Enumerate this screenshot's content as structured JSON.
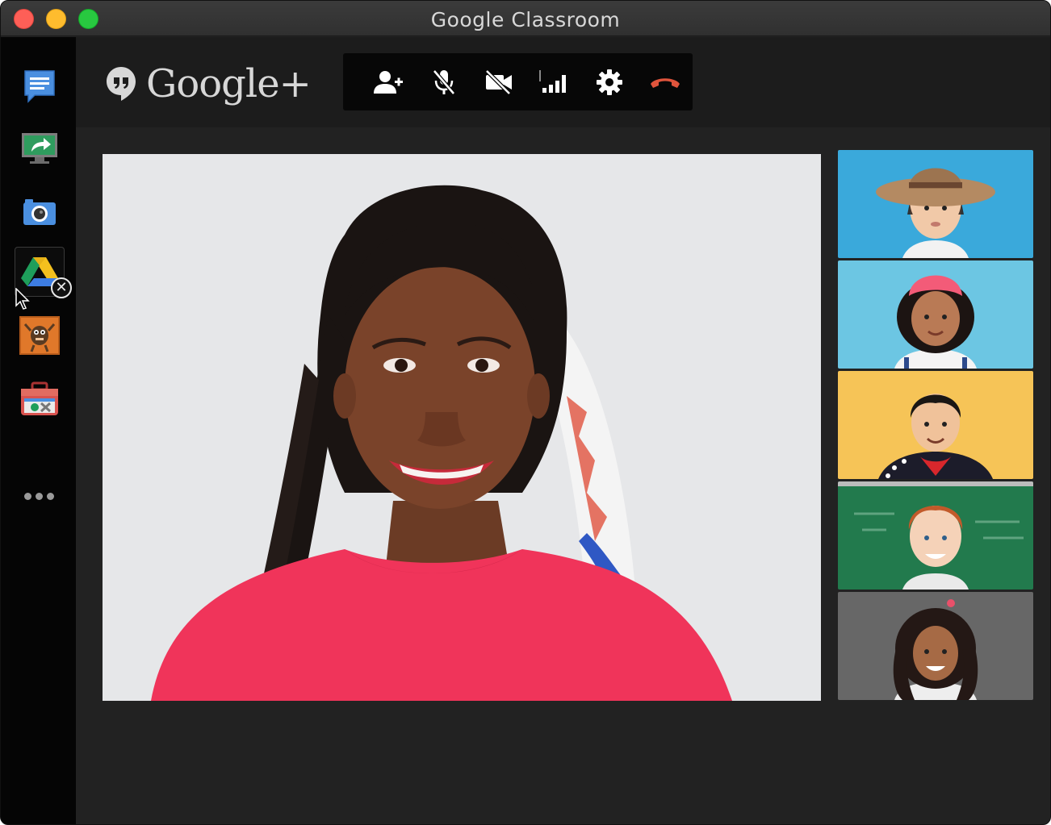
{
  "window": {
    "title": "Google Classroom"
  },
  "brand": {
    "name": "Google+",
    "logo_icon": "hangouts-quote-icon"
  },
  "sidebar": {
    "items": [
      {
        "name": "chat",
        "icon": "chat-message-icon",
        "color": "#4a89dc"
      },
      {
        "name": "screenshare",
        "icon": "screenshare-icon",
        "color": "#2e9b57"
      },
      {
        "name": "capture",
        "icon": "camera-icon",
        "color": "#4a89dc"
      },
      {
        "name": "drive",
        "icon": "google-drive-icon",
        "active": true
      },
      {
        "name": "effects",
        "icon": "monster-effects-icon",
        "color": "#e07b2c"
      },
      {
        "name": "toolbox",
        "icon": "toolbox-icon",
        "color": "#d9534f"
      }
    ],
    "close_badge": "✕",
    "more_icon": "more-dots-icon"
  },
  "toolbar": {
    "buttons": [
      {
        "name": "invite",
        "icon": "add-person-icon"
      },
      {
        "name": "mute-mic",
        "icon": "mic-off-icon"
      },
      {
        "name": "video-off",
        "icon": "camera-off-icon"
      },
      {
        "name": "bandwidth",
        "icon": "signal-bars-icon"
      },
      {
        "name": "settings",
        "icon": "gear-icon"
      },
      {
        "name": "end-call",
        "icon": "hangup-phone-icon",
        "color": "#e0543c"
      }
    ]
  },
  "participants": {
    "main": {
      "background": "#e6e7e9",
      "shirt": "#f0345a"
    },
    "thumbnails": [
      {
        "background": "#3aa9db"
      },
      {
        "background": "#6cc6e3"
      },
      {
        "background": "#f6c457"
      },
      {
        "background": "#227a4d"
      },
      {
        "background": "#5a5a5a"
      }
    ]
  }
}
